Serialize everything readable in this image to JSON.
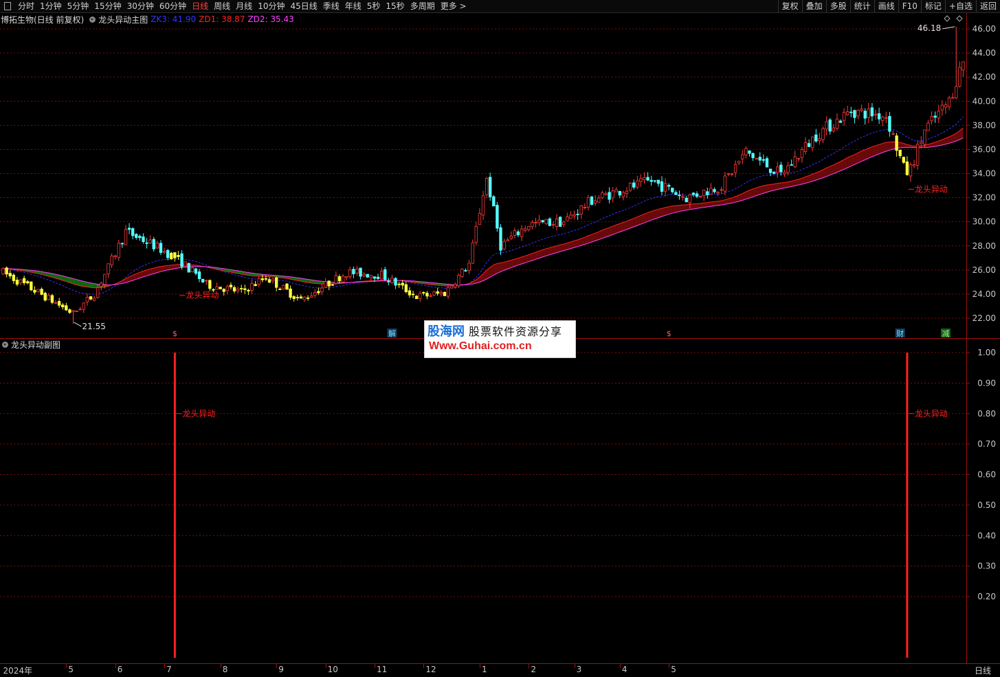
{
  "toolbar": {
    "periods": [
      "分时",
      "1分钟",
      "5分钟",
      "15分钟",
      "30分钟",
      "60分钟",
      "日线",
      "周线",
      "月线",
      "10分钟",
      "45日线",
      "季线",
      "年线",
      "5秒",
      "15秒",
      "多周期",
      "更多 >"
    ],
    "active_period": "日线",
    "right_buttons": [
      "复权",
      "叠加",
      "多股",
      "统计",
      "画线",
      "F10",
      "标记",
      "+自选",
      "返回"
    ]
  },
  "main_panel": {
    "stock": "博拓生物(日线 前复权)",
    "indicator": "龙头异动主图",
    "zk3_label": "ZK3: 41.90",
    "zd1_label": "ZD1: 38.87",
    "zd2_label": "ZD2: 35.43",
    "high_marker": "46.18",
    "low_marker": "21.55",
    "signal_text": "龙头异动",
    "event_badges": [
      "$",
      "解",
      "$",
      "财",
      "减"
    ]
  },
  "sub_panel": {
    "indicator": "龙头异动副图",
    "signal_text": "龙头异动"
  },
  "bottom_right": "日线",
  "watermark": {
    "logo": "股海网",
    "slogan": "股票软件资源分享",
    "url": "Www.Guhai.com.cn"
  },
  "colors": {
    "up": "#ff3c3c",
    "down": "#54ffff",
    "zk3": "#3333ff",
    "zd1": "#ff2020",
    "zd2": "#ff40ff",
    "band_up": "#6a0a0a",
    "band_down": "#0f6a0f",
    "grid": "#7a1010",
    "signal": "#ff2020",
    "signal_candle": "#ffff40"
  },
  "chart_data": [
    {
      "type": "candlestick",
      "title": "龙头异动主图",
      "y_ticks": [
        "46.00",
        "44.00",
        "42.00",
        "40.00",
        "38.00",
        "36.00",
        "34.00",
        "32.00",
        "30.00",
        "28.00",
        "26.00",
        "24.00",
        "22.00"
      ],
      "ylim": [
        20.6,
        47.0
      ],
      "x_ticks": [
        "2024年",
        "5",
        "6",
        "7",
        "8",
        "9",
        "10",
        "11",
        "12",
        "1",
        "2",
        "3",
        "4",
        "5"
      ],
      "n_bars": 275,
      "anchors": [
        [
          0,
          25.8
        ],
        [
          12,
          23.8
        ],
        [
          20,
          22.4
        ],
        [
          26,
          24.0
        ],
        [
          30,
          26.2
        ],
        [
          35,
          29.2
        ],
        [
          42,
          28.2
        ],
        [
          50,
          26.9
        ],
        [
          58,
          24.8
        ],
        [
          68,
          24.2
        ],
        [
          75,
          25.4
        ],
        [
          85,
          23.5
        ],
        [
          98,
          25.8
        ],
        [
          108,
          25.6
        ],
        [
          118,
          23.8
        ],
        [
          126,
          24.1
        ],
        [
          133,
          26.5
        ],
        [
          138,
          33.8
        ],
        [
          142,
          28.0
        ],
        [
          150,
          29.8
        ],
        [
          160,
          30.0
        ],
        [
          168,
          31.8
        ],
        [
          176,
          32.6
        ],
        [
          185,
          33.4
        ],
        [
          195,
          32.0
        ],
        [
          205,
          33.0
        ],
        [
          212,
          35.8
        ],
        [
          222,
          33.9
        ],
        [
          232,
          37.2
        ],
        [
          242,
          39.2
        ],
        [
          252,
          38.8
        ],
        [
          258,
          33.6
        ],
        [
          263,
          37.6
        ],
        [
          270,
          40.0
        ],
        [
          274,
          43.4
        ],
        [
          276,
          45.4
        ],
        [
          278,
          44.0
        ]
      ],
      "series": [
        {
          "name": "ZK3",
          "value": 41.9
        },
        {
          "name": "ZD1",
          "value": 38.87
        },
        {
          "name": "ZD2",
          "value": 35.43
        }
      ],
      "annotations": [
        "46.18",
        "21.55",
        "龙头异动"
      ]
    },
    {
      "type": "bar",
      "title": "龙头异动副图",
      "y_ticks": [
        "1.00",
        "0.90",
        "0.80",
        "0.70",
        "0.60",
        "0.50",
        "0.40",
        "0.30",
        "0.20"
      ],
      "ylim": [
        0,
        1.0
      ],
      "signals": [
        {
          "date_label": "6",
          "value": 1.0,
          "label": "龙头异动"
        },
        {
          "date_label": "4",
          "value": 1.0,
          "label": "龙头异动"
        }
      ]
    }
  ]
}
